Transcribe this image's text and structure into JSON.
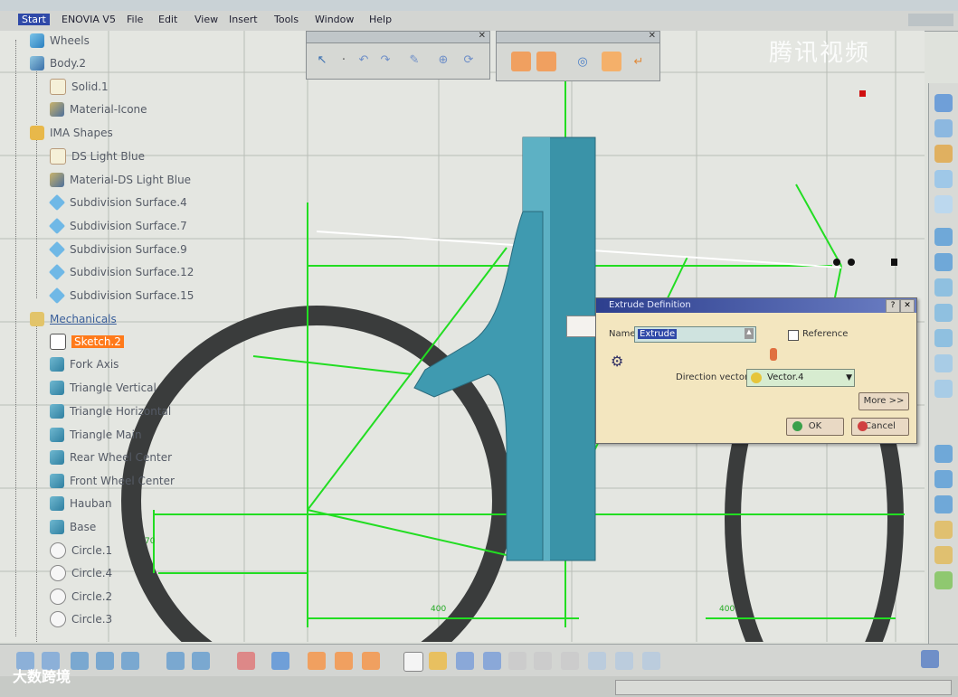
{
  "menu": {
    "items": [
      "Start",
      "ENOVIA V5",
      "File",
      "Edit",
      "View",
      "Insert",
      "Tools",
      "Window",
      "Help"
    ]
  },
  "tree": {
    "root": "Wheels",
    "body": "Body.2",
    "solid": "Solid.1",
    "material_icons": "Material-Icone",
    "ima_shapes": "IMA Shapes",
    "ds_light_blue": "DS Light Blue",
    "material_ds": "Material-DS Light Blue",
    "subdivision_surfaces": [
      "Subdivision Surface.4",
      "Subdivision Surface.7",
      "Subdivision Surface.9",
      "Subdivision Surface.12",
      "Subdivision Surface.15"
    ],
    "mechanicals": "Mechanicals",
    "items": [
      "Sketch.2",
      "Fork Axis",
      "Triangle Vertical",
      "Triangle Horizontal",
      "Triangle Main",
      "Rear Wheel Center",
      "Front Wheel Center",
      "Hauban",
      "Base",
      "Circle.1",
      "Circle.4",
      "Circle.2",
      "Circle.3"
    ]
  },
  "dialog": {
    "title": "Extrude Definition",
    "name_label": "Name:",
    "name_value": "Extrude",
    "reference_label": "Reference",
    "direction_label": "Direction vector:",
    "direction_value": "Vector.4",
    "more_label": "More >>",
    "ok_label": "OK",
    "cancel_label": "Cancel"
  },
  "dimensions": [
    "400",
    "400",
    "70"
  ],
  "watermark": "腾讯视频",
  "brand": "大数跨境",
  "colors": {
    "menu_active": "#2f49a8",
    "selection_orange": "#ff7a1a",
    "dialog_bg": "#f3e6bf",
    "sketch_green": "#22dd22",
    "extrude_teal": "#3a93a8",
    "wheel_dark": "#3a3c3c"
  }
}
